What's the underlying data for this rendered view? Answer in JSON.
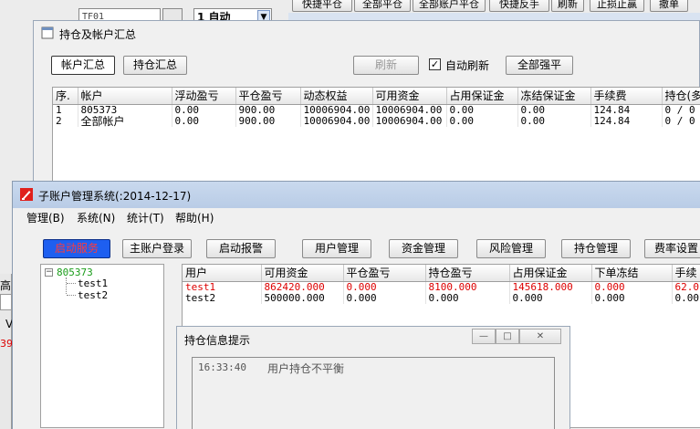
{
  "bg": {
    "toolbar": [
      "快捷平仓",
      "全部平仓",
      "全部账户平仓",
      "快捷反手",
      "刷新",
      "止损止赢",
      "撤单"
    ],
    "field1": "TF01",
    "field2": "1 自动"
  },
  "left_frag": {
    "text1": "高",
    "text2": "V",
    "text3": "39"
  },
  "win1": {
    "title": "持仓及帐户汇总",
    "tab_account": "帐户汇总",
    "tab_position": "持仓汇总",
    "refresh": "刷新",
    "auto_refresh_label": "自动刷新",
    "auto_refresh_checked": true,
    "force_close_all": "全部强平",
    "columns": [
      "序.",
      "帐户",
      "浮动盈亏",
      "平仓盈亏",
      "动态权益",
      "可用资金",
      "占用保证金",
      "冻结保证金",
      "手续费",
      "持仓(多"
    ],
    "rows": [
      [
        "1",
        "805373",
        "0.00",
        "900.00",
        "10006904.00",
        "10006904.00",
        "0.00",
        "0.00",
        "124.84",
        "0 / 0"
      ],
      [
        "2",
        "全部帐户",
        "0.00",
        "900.00",
        "10006904.00",
        "10006904.00",
        "0.00",
        "0.00",
        "124.84",
        "0 / 0"
      ]
    ]
  },
  "win2": {
    "title": "子账户管理系统(:2014-12-17)",
    "menu": [
      "管理(B)",
      "系统(N)",
      "统计(T)",
      "帮助(H)"
    ],
    "buttons": {
      "start_service": "启动服务",
      "main_login": "主账户登录",
      "start_alarm": "启动报警",
      "user_mgmt": "用户管理",
      "fund_mgmt": "资金管理",
      "risk_mgmt": "风险管理",
      "position_mgmt": "持仓管理",
      "fee_settings": "费率设置"
    },
    "tree": {
      "root": "805373",
      "children": [
        "test1",
        "test2"
      ]
    },
    "columns": [
      "用户",
      "可用资金",
      "平仓盈亏",
      "持仓盈亏",
      "占用保证金",
      "下单冻结",
      "手续"
    ],
    "rows": [
      {
        "alert": true,
        "cells": [
          "test1",
          "862420.000",
          "0.000",
          "8100.000",
          "145618.000",
          "0.000",
          "62.0"
        ]
      },
      {
        "alert": false,
        "cells": [
          "test2",
          "500000.000",
          "0.000",
          "0.000",
          "0.000",
          "0.000",
          "0.00"
        ]
      }
    ]
  },
  "win3": {
    "title": "持仓信息提示",
    "message_time": "16:33:40",
    "message_text": "用户持仓不平衡"
  },
  "colors": {
    "start_button_bg": "#1e5ff0",
    "start_button_text": "#ff3b3b",
    "alert_row_text": "#dd0000",
    "tree_root_text": "#1a9c1a"
  }
}
